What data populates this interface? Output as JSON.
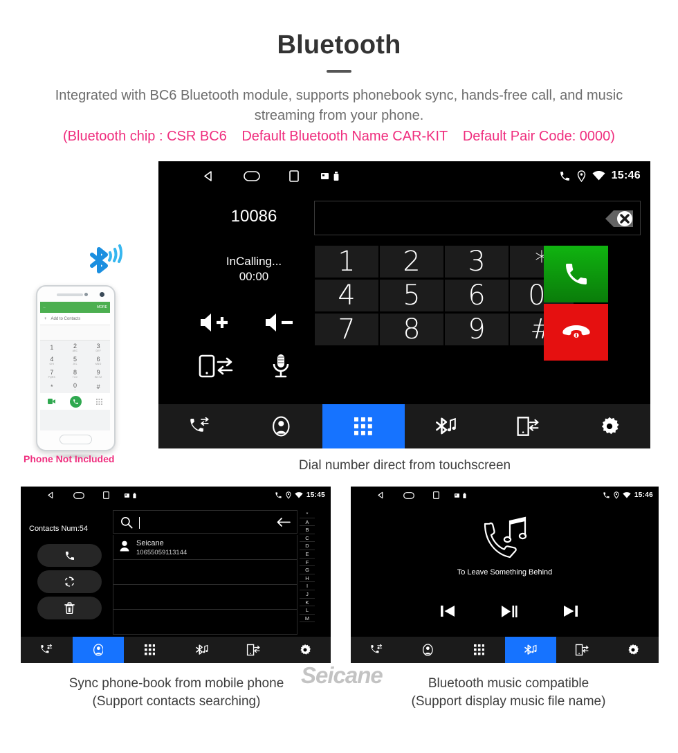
{
  "header": {
    "title": "Bluetooth",
    "subtitle": "Integrated with BC6 Bluetooth module, supports phonebook sync, hands-free call, and music streaming from your phone.",
    "spec_chip": "(Bluetooth chip : CSR BC6",
    "spec_name": "Default Bluetooth Name CAR-KIT",
    "spec_code": "Default Pair Code: 0000)",
    "accent_pink": "#ef2e7e",
    "accent_blue": "#1673ff"
  },
  "phone_mock": {
    "not_included_label": "Phone Not Included",
    "appbar_more": "MORE",
    "add_to_contacts": "Add to Contacts",
    "keys": [
      {
        "d": "1",
        "s": ""
      },
      {
        "d": "2",
        "s": "ABC"
      },
      {
        "d": "3",
        "s": "DEF"
      },
      {
        "d": "4",
        "s": "GHI"
      },
      {
        "d": "5",
        "s": "JKL"
      },
      {
        "d": "6",
        "s": "MNO"
      },
      {
        "d": "7",
        "s": "PQRS"
      },
      {
        "d": "8",
        "s": "TUV"
      },
      {
        "d": "9",
        "s": "WXYZ"
      },
      {
        "d": "*",
        "s": ""
      },
      {
        "d": "0",
        "s": "+"
      },
      {
        "d": "#",
        "s": ""
      }
    ]
  },
  "dialer": {
    "status_bar": {
      "time": "15:46"
    },
    "number": "10086",
    "call_status": "InCalling...",
    "call_timer": "00:00",
    "input_value": "",
    "keys": [
      "1",
      "2",
      "3",
      "*",
      "4",
      "5",
      "6",
      "0",
      "7",
      "8",
      "9",
      "#"
    ],
    "zero_superscript": "+",
    "side_buttons": [
      "volume-up",
      "volume-down",
      "transfer-audio",
      "mute-mic"
    ],
    "nav": [
      {
        "icon": "call-log-icon",
        "active": false
      },
      {
        "icon": "contacts-icon",
        "active": false
      },
      {
        "icon": "keypad-icon",
        "active": true
      },
      {
        "icon": "bluetooth-music-icon",
        "active": false
      },
      {
        "icon": "phone-link-icon",
        "active": false
      },
      {
        "icon": "settings-gear-icon",
        "active": false
      }
    ],
    "caption": "Dial number direct from touchscreen"
  },
  "contacts": {
    "status_bar": {
      "time": "15:45"
    },
    "count_label": "Contacts Num:54",
    "side_buttons": [
      "dial-icon",
      "sync-icon",
      "delete-icon"
    ],
    "search_value": "",
    "rows": [
      {
        "name": "Seicane",
        "phone": "10655059113144"
      },
      {
        "name": "",
        "phone": ""
      },
      {
        "name": "",
        "phone": ""
      },
      {
        "name": "",
        "phone": ""
      }
    ],
    "alpha_index": [
      "*",
      "A",
      "B",
      "C",
      "D",
      "E",
      "F",
      "G",
      "H",
      "I",
      "J",
      "K",
      "L",
      "M"
    ],
    "nav": [
      {
        "icon": "call-log-icon",
        "active": false
      },
      {
        "icon": "contacts-icon",
        "active": true
      },
      {
        "icon": "keypad-icon",
        "active": false
      },
      {
        "icon": "bluetooth-music-icon",
        "active": false
      },
      {
        "icon": "phone-link-icon",
        "active": false
      },
      {
        "icon": "settings-gear-icon",
        "active": false
      }
    ],
    "caption_line1": "Sync phone-book from mobile phone",
    "caption_line2": "(Support contacts searching)"
  },
  "music": {
    "status_bar": {
      "time": "15:46"
    },
    "track_title": "To Leave Something Behind",
    "controls": [
      "previous-track",
      "play-pause",
      "next-track"
    ],
    "nav": [
      {
        "icon": "call-log-icon",
        "active": false
      },
      {
        "icon": "contacts-icon",
        "active": false
      },
      {
        "icon": "keypad-icon",
        "active": false
      },
      {
        "icon": "bluetooth-music-icon",
        "active": true
      },
      {
        "icon": "phone-link-icon",
        "active": false
      },
      {
        "icon": "settings-gear-icon",
        "active": false
      }
    ],
    "caption_line1": "Bluetooth music compatible",
    "caption_line2": "(Support display music file name)"
  },
  "watermark": "Seicane"
}
